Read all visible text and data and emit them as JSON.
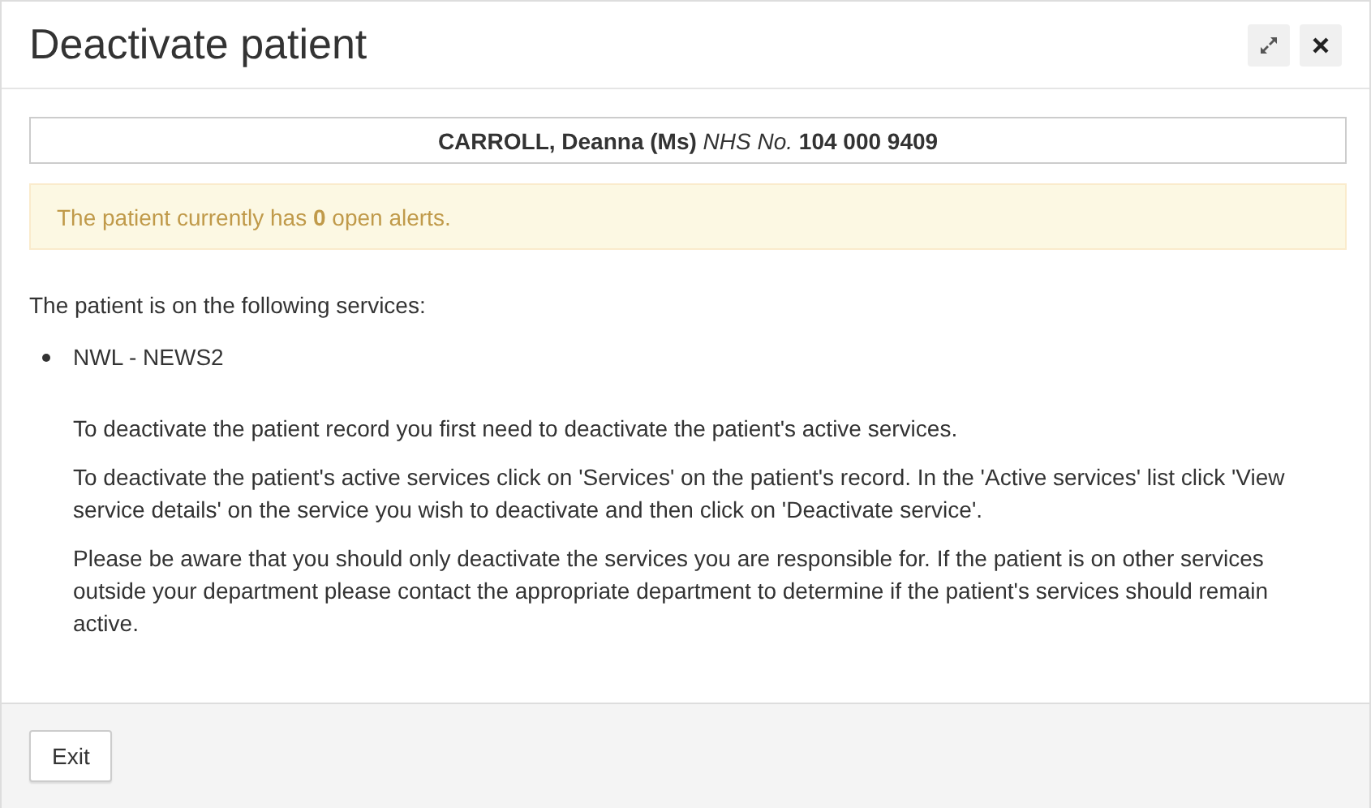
{
  "dialog": {
    "title": "Deactivate patient"
  },
  "patient_banner": "**CARROLL, Deanna (Ms)** *NHS No.* **104 000 9409**",
  "alert": "The patient currently has **0** open alerts.",
  "services_intro": "The patient is on the following services:",
  "services": [
    "NWL - NEWS2"
  ],
  "paragraphs": [
    "To deactivate the patient record you first need to deactivate the patient's active services.",
    "To deactivate the patient's active services click on 'Services' on the patient's record. In the 'Active services' list click 'View service details' on the service you wish to deactivate and then click on 'Deactivate service'.",
    "Please be aware that you should only deactivate the services you are responsible for. If the patient is on other services outside your department please contact the appropriate department to determine if the patient's services should remain active."
  ],
  "footer_buttons": [
    "Exit"
  ]
}
